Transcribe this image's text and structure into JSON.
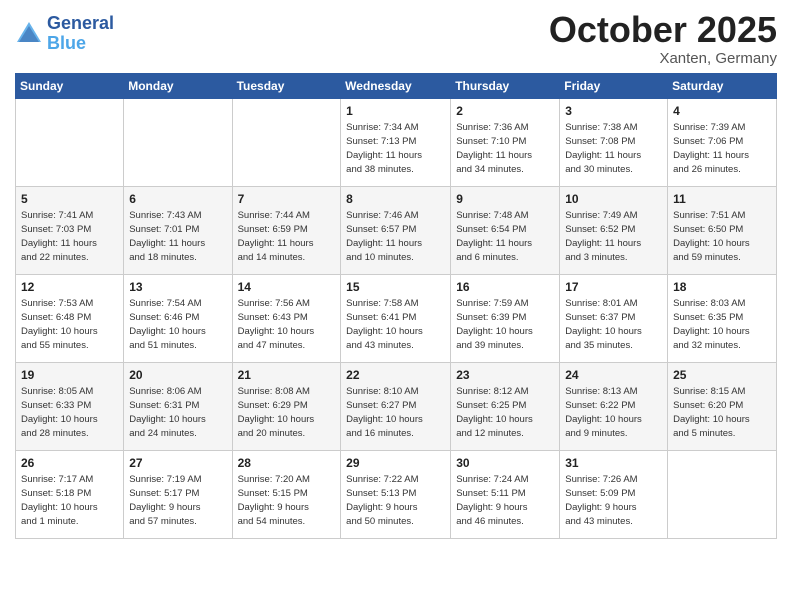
{
  "header": {
    "logo_line1": "General",
    "logo_line2": "Blue",
    "month": "October 2025",
    "location": "Xanten, Germany"
  },
  "weekdays": [
    "Sunday",
    "Monday",
    "Tuesday",
    "Wednesday",
    "Thursday",
    "Friday",
    "Saturday"
  ],
  "weeks": [
    [
      {
        "day": "",
        "info": ""
      },
      {
        "day": "",
        "info": ""
      },
      {
        "day": "",
        "info": ""
      },
      {
        "day": "1",
        "info": "Sunrise: 7:34 AM\nSunset: 7:13 PM\nDaylight: 11 hours\nand 38 minutes."
      },
      {
        "day": "2",
        "info": "Sunrise: 7:36 AM\nSunset: 7:10 PM\nDaylight: 11 hours\nand 34 minutes."
      },
      {
        "day": "3",
        "info": "Sunrise: 7:38 AM\nSunset: 7:08 PM\nDaylight: 11 hours\nand 30 minutes."
      },
      {
        "day": "4",
        "info": "Sunrise: 7:39 AM\nSunset: 7:06 PM\nDaylight: 11 hours\nand 26 minutes."
      }
    ],
    [
      {
        "day": "5",
        "info": "Sunrise: 7:41 AM\nSunset: 7:03 PM\nDaylight: 11 hours\nand 22 minutes."
      },
      {
        "day": "6",
        "info": "Sunrise: 7:43 AM\nSunset: 7:01 PM\nDaylight: 11 hours\nand 18 minutes."
      },
      {
        "day": "7",
        "info": "Sunrise: 7:44 AM\nSunset: 6:59 PM\nDaylight: 11 hours\nand 14 minutes."
      },
      {
        "day": "8",
        "info": "Sunrise: 7:46 AM\nSunset: 6:57 PM\nDaylight: 11 hours\nand 10 minutes."
      },
      {
        "day": "9",
        "info": "Sunrise: 7:48 AM\nSunset: 6:54 PM\nDaylight: 11 hours\nand 6 minutes."
      },
      {
        "day": "10",
        "info": "Sunrise: 7:49 AM\nSunset: 6:52 PM\nDaylight: 11 hours\nand 3 minutes."
      },
      {
        "day": "11",
        "info": "Sunrise: 7:51 AM\nSunset: 6:50 PM\nDaylight: 10 hours\nand 59 minutes."
      }
    ],
    [
      {
        "day": "12",
        "info": "Sunrise: 7:53 AM\nSunset: 6:48 PM\nDaylight: 10 hours\nand 55 minutes."
      },
      {
        "day": "13",
        "info": "Sunrise: 7:54 AM\nSunset: 6:46 PM\nDaylight: 10 hours\nand 51 minutes."
      },
      {
        "day": "14",
        "info": "Sunrise: 7:56 AM\nSunset: 6:43 PM\nDaylight: 10 hours\nand 47 minutes."
      },
      {
        "day": "15",
        "info": "Sunrise: 7:58 AM\nSunset: 6:41 PM\nDaylight: 10 hours\nand 43 minutes."
      },
      {
        "day": "16",
        "info": "Sunrise: 7:59 AM\nSunset: 6:39 PM\nDaylight: 10 hours\nand 39 minutes."
      },
      {
        "day": "17",
        "info": "Sunrise: 8:01 AM\nSunset: 6:37 PM\nDaylight: 10 hours\nand 35 minutes."
      },
      {
        "day": "18",
        "info": "Sunrise: 8:03 AM\nSunset: 6:35 PM\nDaylight: 10 hours\nand 32 minutes."
      }
    ],
    [
      {
        "day": "19",
        "info": "Sunrise: 8:05 AM\nSunset: 6:33 PM\nDaylight: 10 hours\nand 28 minutes."
      },
      {
        "day": "20",
        "info": "Sunrise: 8:06 AM\nSunset: 6:31 PM\nDaylight: 10 hours\nand 24 minutes."
      },
      {
        "day": "21",
        "info": "Sunrise: 8:08 AM\nSunset: 6:29 PM\nDaylight: 10 hours\nand 20 minutes."
      },
      {
        "day": "22",
        "info": "Sunrise: 8:10 AM\nSunset: 6:27 PM\nDaylight: 10 hours\nand 16 minutes."
      },
      {
        "day": "23",
        "info": "Sunrise: 8:12 AM\nSunset: 6:25 PM\nDaylight: 10 hours\nand 12 minutes."
      },
      {
        "day": "24",
        "info": "Sunrise: 8:13 AM\nSunset: 6:22 PM\nDaylight: 10 hours\nand 9 minutes."
      },
      {
        "day": "25",
        "info": "Sunrise: 8:15 AM\nSunset: 6:20 PM\nDaylight: 10 hours\nand 5 minutes."
      }
    ],
    [
      {
        "day": "26",
        "info": "Sunrise: 7:17 AM\nSunset: 5:18 PM\nDaylight: 10 hours\nand 1 minute."
      },
      {
        "day": "27",
        "info": "Sunrise: 7:19 AM\nSunset: 5:17 PM\nDaylight: 9 hours\nand 57 minutes."
      },
      {
        "day": "28",
        "info": "Sunrise: 7:20 AM\nSunset: 5:15 PM\nDaylight: 9 hours\nand 54 minutes."
      },
      {
        "day": "29",
        "info": "Sunrise: 7:22 AM\nSunset: 5:13 PM\nDaylight: 9 hours\nand 50 minutes."
      },
      {
        "day": "30",
        "info": "Sunrise: 7:24 AM\nSunset: 5:11 PM\nDaylight: 9 hours\nand 46 minutes."
      },
      {
        "day": "31",
        "info": "Sunrise: 7:26 AM\nSunset: 5:09 PM\nDaylight: 9 hours\nand 43 minutes."
      },
      {
        "day": "",
        "info": ""
      }
    ]
  ]
}
